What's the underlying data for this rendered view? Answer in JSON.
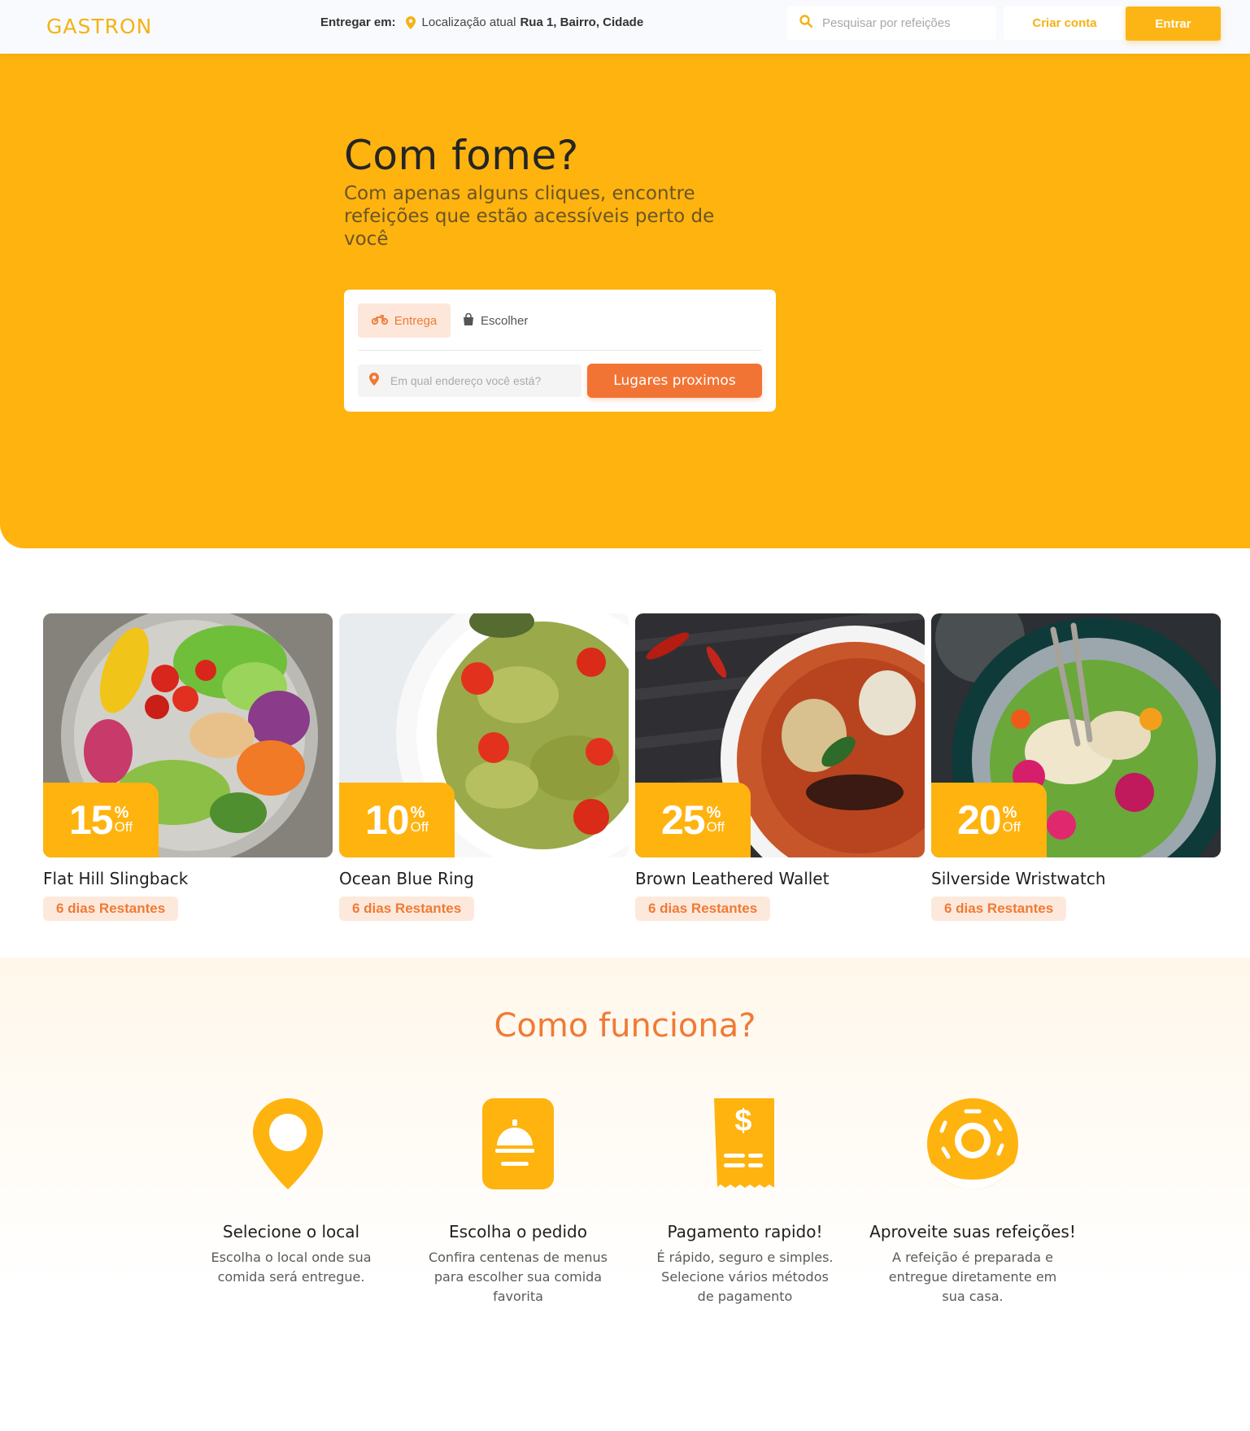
{
  "brand": {
    "logo": "GASTRON"
  },
  "nav": {
    "deliver_label": "Entregar em:",
    "location_label": "Localização atual",
    "location_address": "Rua 1, Bairro, Cidade",
    "search_placeholder": "Pesquisar por refeições",
    "signup": "Criar conta",
    "login": "Entrar"
  },
  "hero": {
    "title": "Com fome?",
    "subtitle": "Com apenas alguns cliques, encontre refeições que estão acessíveis perto de você",
    "tab_delivery": "Entrega",
    "tab_pickup": "Escolher",
    "address_placeholder": "Em qual endereço você está?",
    "cta": "Lugares proximos"
  },
  "deals": [
    {
      "discount": "15",
      "percent": "%",
      "off": "Off",
      "title": "Flat Hill Slingback",
      "remaining": "6 dias Restantes"
    },
    {
      "discount": "10",
      "percent": "%",
      "off": "Off",
      "title": "Ocean Blue Ring",
      "remaining": "6 dias Restantes"
    },
    {
      "discount": "25",
      "percent": "%",
      "off": "Off",
      "title": "Brown Leathered Wallet",
      "remaining": "6 dias Restantes"
    },
    {
      "discount": "20",
      "percent": "%",
      "off": "Off",
      "title": "Silverside Wristwatch",
      "remaining": "6 dias Restantes"
    }
  ],
  "how": {
    "title": "Como funciona?",
    "steps": [
      {
        "icon": "location-pin-icon",
        "title": "Selecione o local",
        "text": "Escolha o local onde sua comida será entregue."
      },
      {
        "icon": "food-cloche-icon",
        "title": "Escolha o pedido",
        "text": "Confira centenas de menus para escolher sua comida favorita"
      },
      {
        "icon": "receipt-dollar-icon",
        "title": "Pagamento rapido!",
        "text": "É rápido, seguro e simples. Selecione vários métodos de pagamento"
      },
      {
        "icon": "donut-icon",
        "title": "Aproveite suas refeições!",
        "text": "A refeição é preparada e entregue diretamente em sua casa."
      }
    ]
  },
  "colors": {
    "primary": "#ffb30e",
    "accent": "#f27434",
    "dark": "#252525"
  }
}
